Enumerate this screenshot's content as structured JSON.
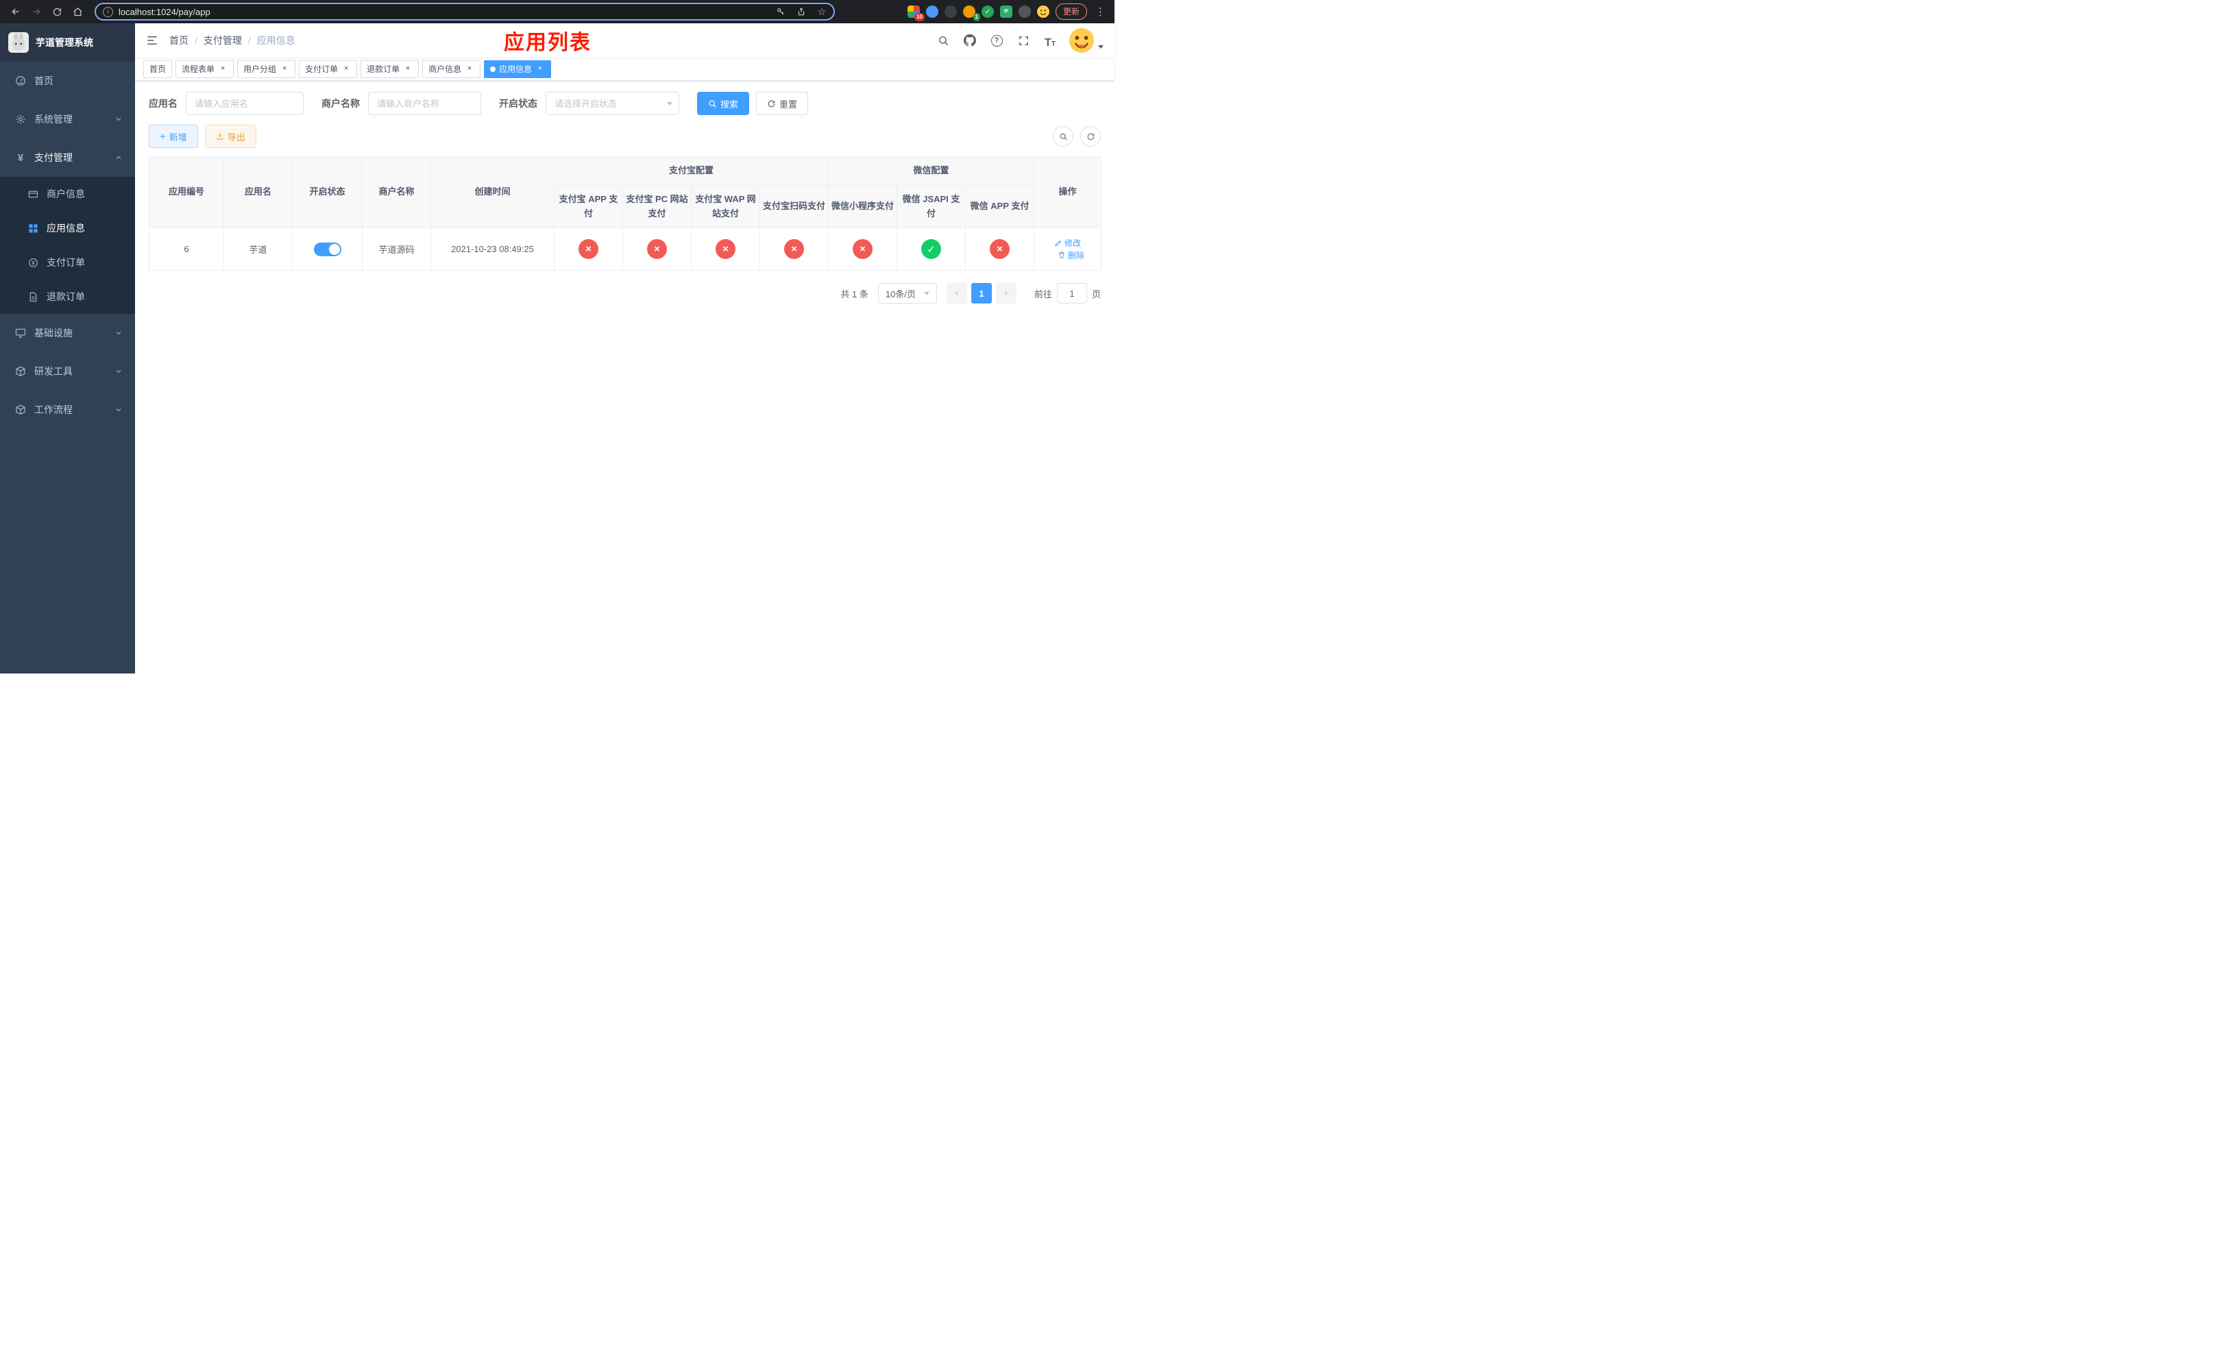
{
  "colors": {
    "accent": "#409eff",
    "success": "#13ce66",
    "danger": "#f25a55",
    "warning": "#e6a23c",
    "annotation": "#ff1a00",
    "sidebar_bg": "#304156",
    "submenu_bg": "#1f2d3d"
  },
  "browser": {
    "url": "localhost:1024/pay/app",
    "update_label": "更新",
    "ext_badge_red": "10",
    "ext_badge_green": "1"
  },
  "sidebar": {
    "logo_title": "芋道管理系统",
    "home": "首页",
    "system": "系统管理",
    "payment": "支付管理",
    "merchant_info": "商户信息",
    "app_info": "应用信息",
    "pay_order": "支付订单",
    "refund_order": "退款订单",
    "infrastructure": "基础设施",
    "dev_tools": "研发工具",
    "workflow": "工作流程"
  },
  "breadcrumb": {
    "home": "首页",
    "payment": "支付管理",
    "current": "应用信息"
  },
  "annotation": "应用列表",
  "tabs": {
    "home": "首页",
    "process_form": "流程表单",
    "user_group": "用户分组",
    "pay_order": "支付订单",
    "refund_order": "退款订单",
    "merchant_info": "商户信息",
    "app_info": "应用信息"
  },
  "filters": {
    "app_name_label": "应用名",
    "app_name_placeholder": "请输入应用名",
    "merchant_label": "商户名称",
    "merchant_placeholder": "请输入商户名称",
    "status_label": "开启状态",
    "status_placeholder": "请选择开启状态",
    "search_label": "搜索",
    "reset_label": "重置"
  },
  "toolbar": {
    "add_label": "新增",
    "export_label": "导出"
  },
  "table": {
    "col_app_id": "应用编号",
    "col_app_name": "应用名",
    "col_status": "开启状态",
    "col_merchant": "商户名称",
    "col_create_time": "创建时间",
    "group_alipay": "支付宝配置",
    "group_wechat": "微信配置",
    "col_alipay_app": "支付宝 APP 支付",
    "col_alipay_pc": "支付宝 PC 网站支付",
    "col_alipay_wap": "支付宝 WAP 网站支付",
    "col_alipay_qr": "支付宝扫码支付",
    "col_wx_lite": "微信小程序支付",
    "col_wx_jsapi": "微信 JSAPI 支付",
    "col_wx_app": "微信 APP 支付",
    "col_actions": "操作",
    "row": {
      "app_id": "6",
      "app_name": "芋道",
      "status_on": true,
      "merchant": "芋道源码",
      "create_time": "2021-10-23 08:49:25",
      "configs": {
        "alipay_app": false,
        "alipay_pc": false,
        "alipay_wap": false,
        "alipay_qr": false,
        "wx_lite": false,
        "wx_jsapi": true,
        "wx_app": false
      },
      "edit_label": "修改",
      "delete_label": "删除"
    }
  },
  "pagination": {
    "total": "共 1 条",
    "page_size": "10条/页",
    "page": "1",
    "goto_label": "前往",
    "goto_value": "1",
    "unit_label": "页"
  }
}
